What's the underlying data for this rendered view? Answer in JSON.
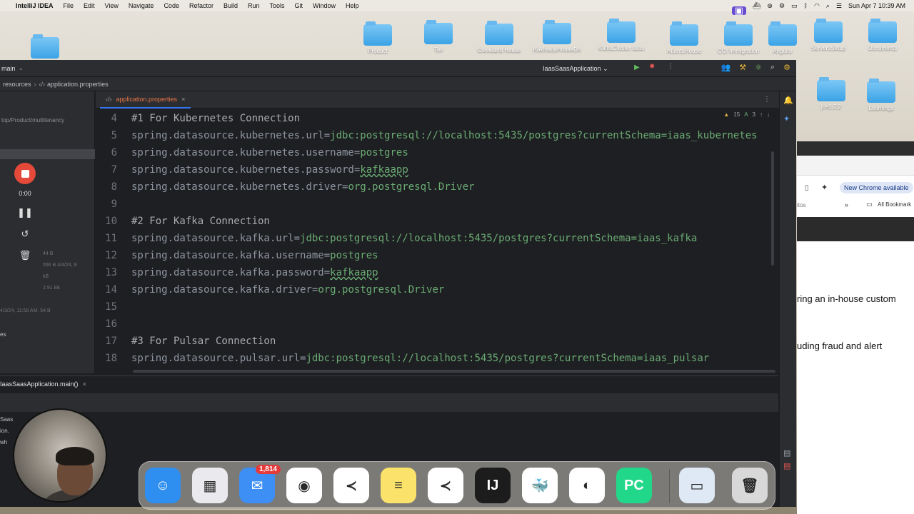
{
  "menubar": {
    "app_name": "IntelliJ IDEA",
    "items": [
      "File",
      "Edit",
      "View",
      "Navigate",
      "Code",
      "Refactor",
      "Build",
      "Run",
      "Tools",
      "Git",
      "Window",
      "Help"
    ],
    "datetime": "Sun Apr 7  10:39 AM"
  },
  "desktop": {
    "folders": [
      "Product",
      "Tax",
      "Cleveland House",
      "KakinadaHouseDo",
      "KafkaCluster alias",
      "AtlantaHouse",
      "CGI Immigration",
      "Angular",
      "ServersSetup",
      "Documents",
      "jce1.2.2",
      "Learnings"
    ]
  },
  "ide": {
    "branch": "main",
    "run_config": "IaasSaasApplication",
    "breadcrumbs": [
      "resources",
      "application.properties"
    ],
    "project_path": "top/Product/multitenancy",
    "project_suffix": "es",
    "project_faint_lines": [
      "44 B",
      "556 B 4/4/24, 8",
      "kB",
      "2.91 kB",
      "4/3/24, 11:58 AM, 54 B"
    ],
    "active_tab": "application.properties",
    "inspection": {
      "warnings": "15",
      "typos": "3"
    },
    "lines": [
      {
        "n": "4",
        "comment": "#1 For Kubernetes Connection"
      },
      {
        "n": "5",
        "key": "spring.datasource.kubernetes.url",
        "value": "jdbc:postgresql://localhost:5435/postgres?currentSchema=iaas_kubernetes"
      },
      {
        "n": "6",
        "key": "spring.datasource.kubernetes.username",
        "value": "postgres"
      },
      {
        "n": "7",
        "key": "spring.datasource.kubernetes.password",
        "value": "kafkaapp",
        "typo": true
      },
      {
        "n": "8",
        "key": "spring.datasource.kubernetes.driver",
        "value": "org.postgresql.Driver"
      },
      {
        "n": "9"
      },
      {
        "n": "10",
        "comment": "#2 For Kafka Connection"
      },
      {
        "n": "11",
        "key": "spring.datasource.kafka.url",
        "value": "jdbc:postgresql://localhost:5435/postgres?currentSchema=iaas_kafka"
      },
      {
        "n": "12",
        "key": "spring.datasource.kafka.username",
        "value": "postgres"
      },
      {
        "n": "13",
        "key": "spring.datasource.kafka.password",
        "value": "kafkaapp",
        "typo": true
      },
      {
        "n": "14",
        "key": "spring.datasource.kafka.driver",
        "value": "org.postgresql.Driver"
      },
      {
        "n": "15"
      },
      {
        "n": "16"
      },
      {
        "n": "17",
        "comment": "#3 For Pulsar Connection"
      },
      {
        "n": "18",
        "key": "spring.datasource.pulsar.url",
        "value": "jdbc:postgresql://localhost:5435/postgres?currentSchema=iaas_pulsar"
      }
    ],
    "run_tab": "IaasSaasApplication.main()",
    "run_output": [
      "Saas",
      "ion.",
      "wh"
    ]
  },
  "recorder": {
    "time": "0:00"
  },
  "browser": {
    "new_chrome": "New Chrome available",
    "bookmarks": "All Bookmark",
    "toolbar_fragment": "itos",
    "text_line_1": "ring an in-house custom",
    "text_line_2": "uding fraud and alert"
  },
  "dock": {
    "apps": [
      {
        "name": "Finder",
        "color": "#2f8ff0",
        "glyph": "☺"
      },
      {
        "name": "Launchpad",
        "color": "#e9e9ee",
        "glyph": "▦"
      },
      {
        "name": "Mail",
        "color": "#3d8ef5",
        "glyph": "✉",
        "badge": "1,814"
      },
      {
        "name": "Chrome",
        "color": "#ffffff",
        "glyph": "◉"
      },
      {
        "name": "VS Code",
        "color": "#ffffff",
        "glyph": "≺"
      },
      {
        "name": "Notes",
        "color": "#fbe26b",
        "glyph": "≡"
      },
      {
        "name": "VS Code 2",
        "color": "#ffffff",
        "glyph": "≺"
      },
      {
        "name": "IntelliJ",
        "color": "#1c1c1c",
        "glyph": "IJ"
      },
      {
        "name": "Docker",
        "color": "#ffffff",
        "glyph": "🐳"
      },
      {
        "name": "DBeaver",
        "color": "#ffffff",
        "glyph": "◐"
      },
      {
        "name": "PyCharm",
        "color": "#21d789",
        "glyph": "PC"
      },
      {
        "name": "Preview",
        "color": "#dfe8f5",
        "glyph": "▭"
      },
      {
        "name": "Trash",
        "color": "#d8d8d8",
        "glyph": "🗑"
      }
    ],
    "colors": {
      "accent": "#3574f0",
      "key": "#8e95a1",
      "value": "#6aab73",
      "record": "#e5493a"
    }
  }
}
